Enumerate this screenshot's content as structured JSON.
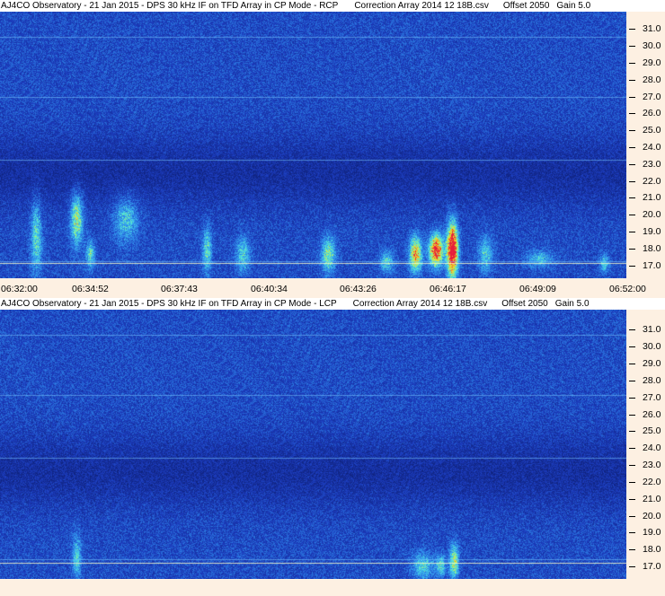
{
  "panels": [
    {
      "id": "rcp",
      "title": {
        "observatory": "AJ4CO Observatory - 21 Jan 2015 - DPS 30 kHz IF on TFD Array in CP Mode - RCP",
        "correction": "Correction Array 2014 12 18B.csv",
        "offset": "Offset 2050",
        "gain": "Gain 5.0"
      }
    },
    {
      "id": "lcp",
      "title": {
        "observatory": "AJ4CO Observatory - 21 Jan 2015 - DPS 30 kHz IF on TFD Array in CP Mode - LCP",
        "correction": "Correction Array 2014 12 18B.csv",
        "offset": "Offset 2050",
        "gain": "Gain 5.0"
      }
    }
  ],
  "y_ticks": [
    "31.0",
    "30.0",
    "29.0",
    "28.0",
    "27.0",
    "26.0",
    "25.0",
    "24.0",
    "23.0",
    "22.0",
    "21.0",
    "20.0",
    "19.0",
    "18.0",
    "17.0"
  ],
  "x_ticks": [
    "06:32:00",
    "06:34:52",
    "06:37:43",
    "06:40:34",
    "06:43:26",
    "06:46:17",
    "06:49:09",
    "06:52:00"
  ],
  "colors": {
    "background": "#fdf0e2",
    "spectrogram_low": "#1b2e8f",
    "spectrogram_high": "#e8203a"
  }
}
